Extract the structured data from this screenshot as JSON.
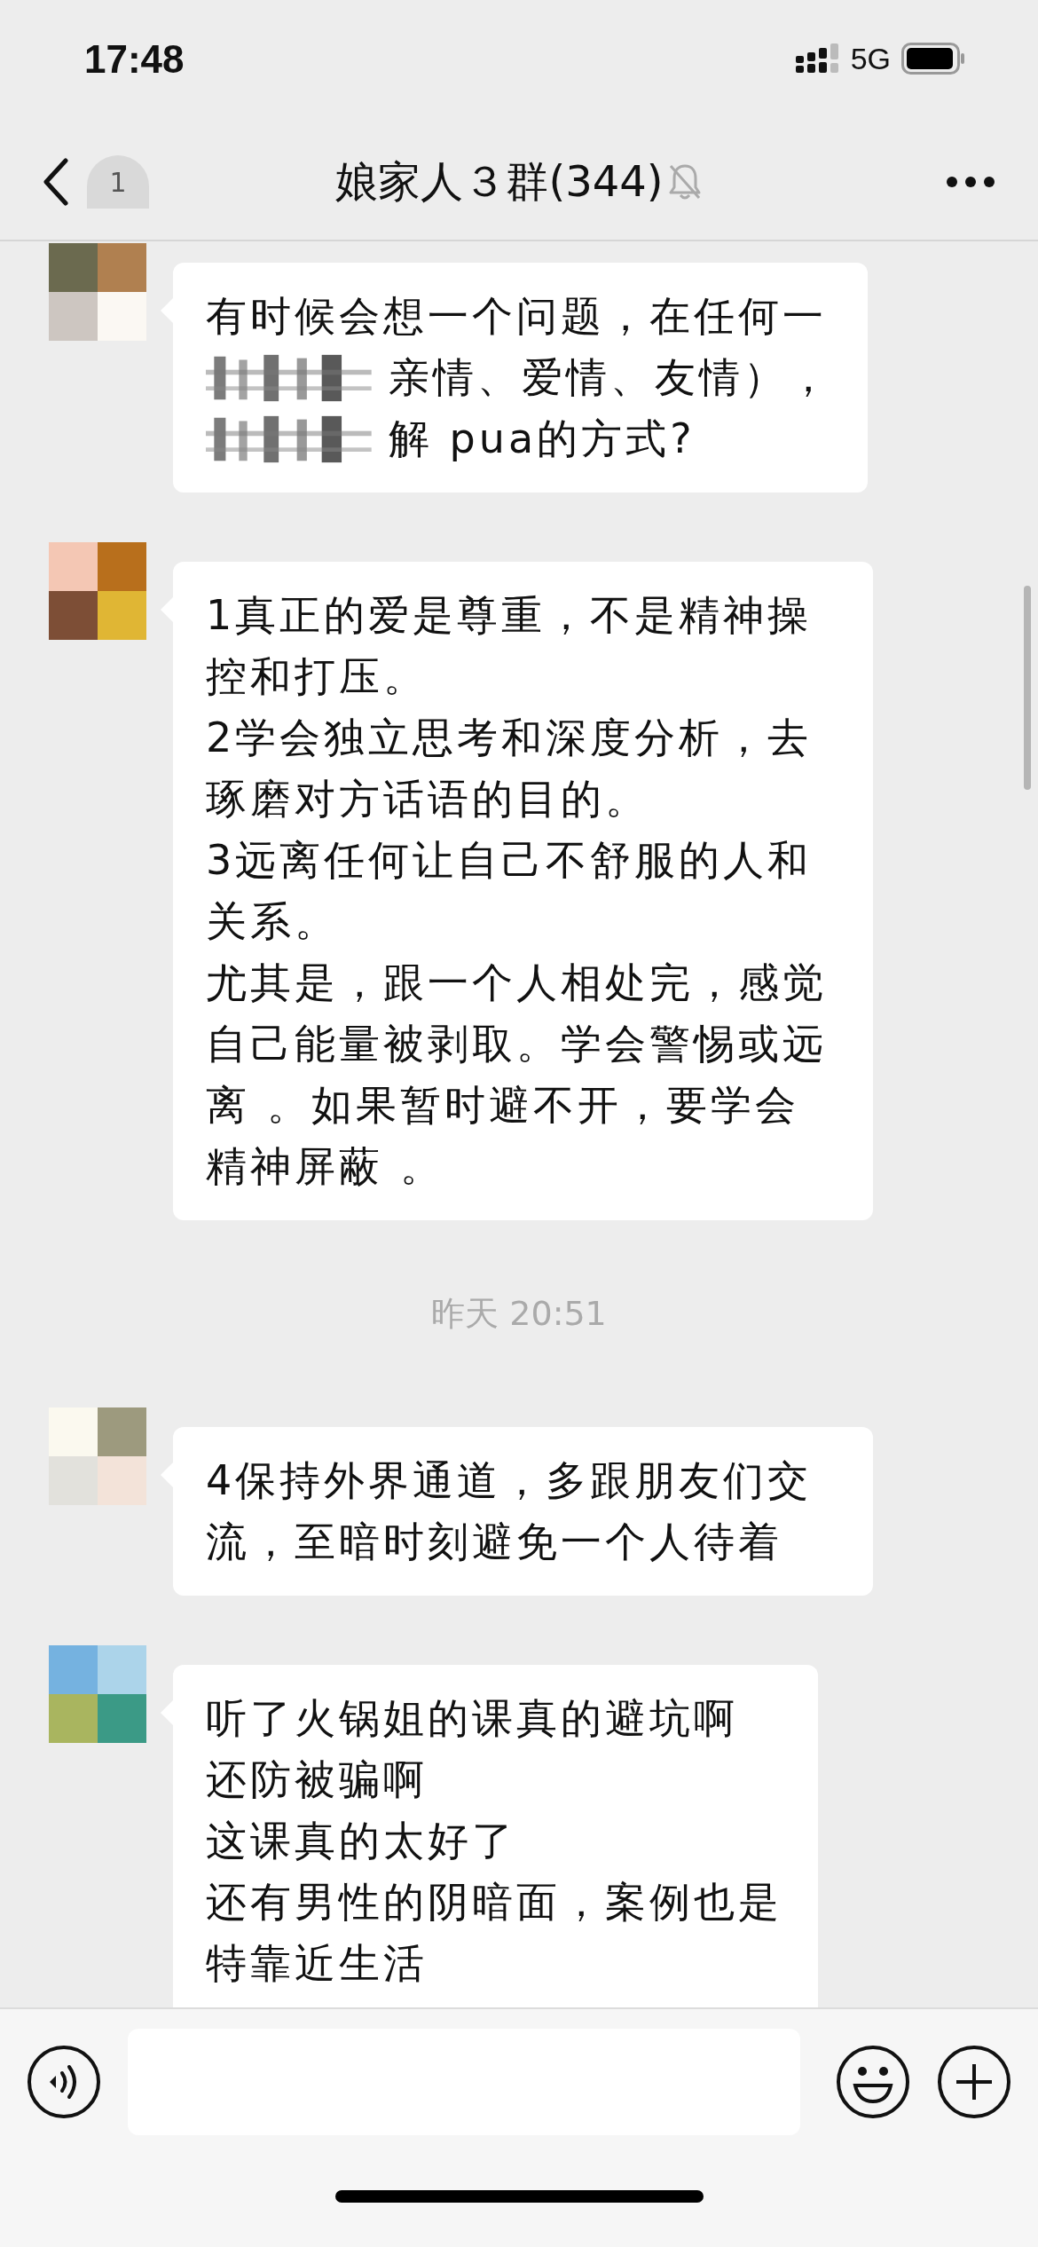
{
  "status_bar": {
    "time": "17:48",
    "network": "5G"
  },
  "nav": {
    "unread_badge": "1",
    "title": "娘家人３群(344)",
    "muted": true
  },
  "messages": [
    {
      "kind": "message",
      "lines": [
        {
          "text": "有时候会想一个问题，在任何一",
          "obscured": false
        },
        {
          "text": "亲情、爱情、友情），",
          "obscured": true
        },
        {
          "text": "解 pua的方式?",
          "obscured": true
        }
      ]
    },
    {
      "kind": "message",
      "lines": [
        {
          "text": "1真正的爱是尊重，不是精神操控和打压。",
          "obscured": false
        },
        {
          "text": "2学会独立思考和深度分析，去琢磨对方话语的目的。",
          "obscured": false
        },
        {
          "text": "3远离任何让自己不舒服的人和关系。",
          "obscured": false
        },
        {
          "text": "尤其是，跟一个人相处完，感觉自己能量被剥取。学会警惕或远离 。如果暂时避不开，要学会精神屏蔽 。",
          "obscured": false
        }
      ]
    },
    {
      "kind": "time",
      "text": "昨天 20:51"
    },
    {
      "kind": "message",
      "lines": [
        {
          "text": "4保持外界通道，多跟朋友们交流，至暗时刻避免一个人待着",
          "obscured": false
        }
      ]
    },
    {
      "kind": "message",
      "lines": [
        {
          "text": "听了火锅姐的课真的避坑啊",
          "obscured": false
        },
        {
          "text": "还防被骗啊",
          "obscured": false
        },
        {
          "text": "这课真的太好了",
          "obscured": false
        },
        {
          "text": "还有男性的阴暗面，案例也是",
          "obscured": false
        },
        {
          "text": "特靠近生活",
          "obscured": false
        }
      ]
    }
  ]
}
